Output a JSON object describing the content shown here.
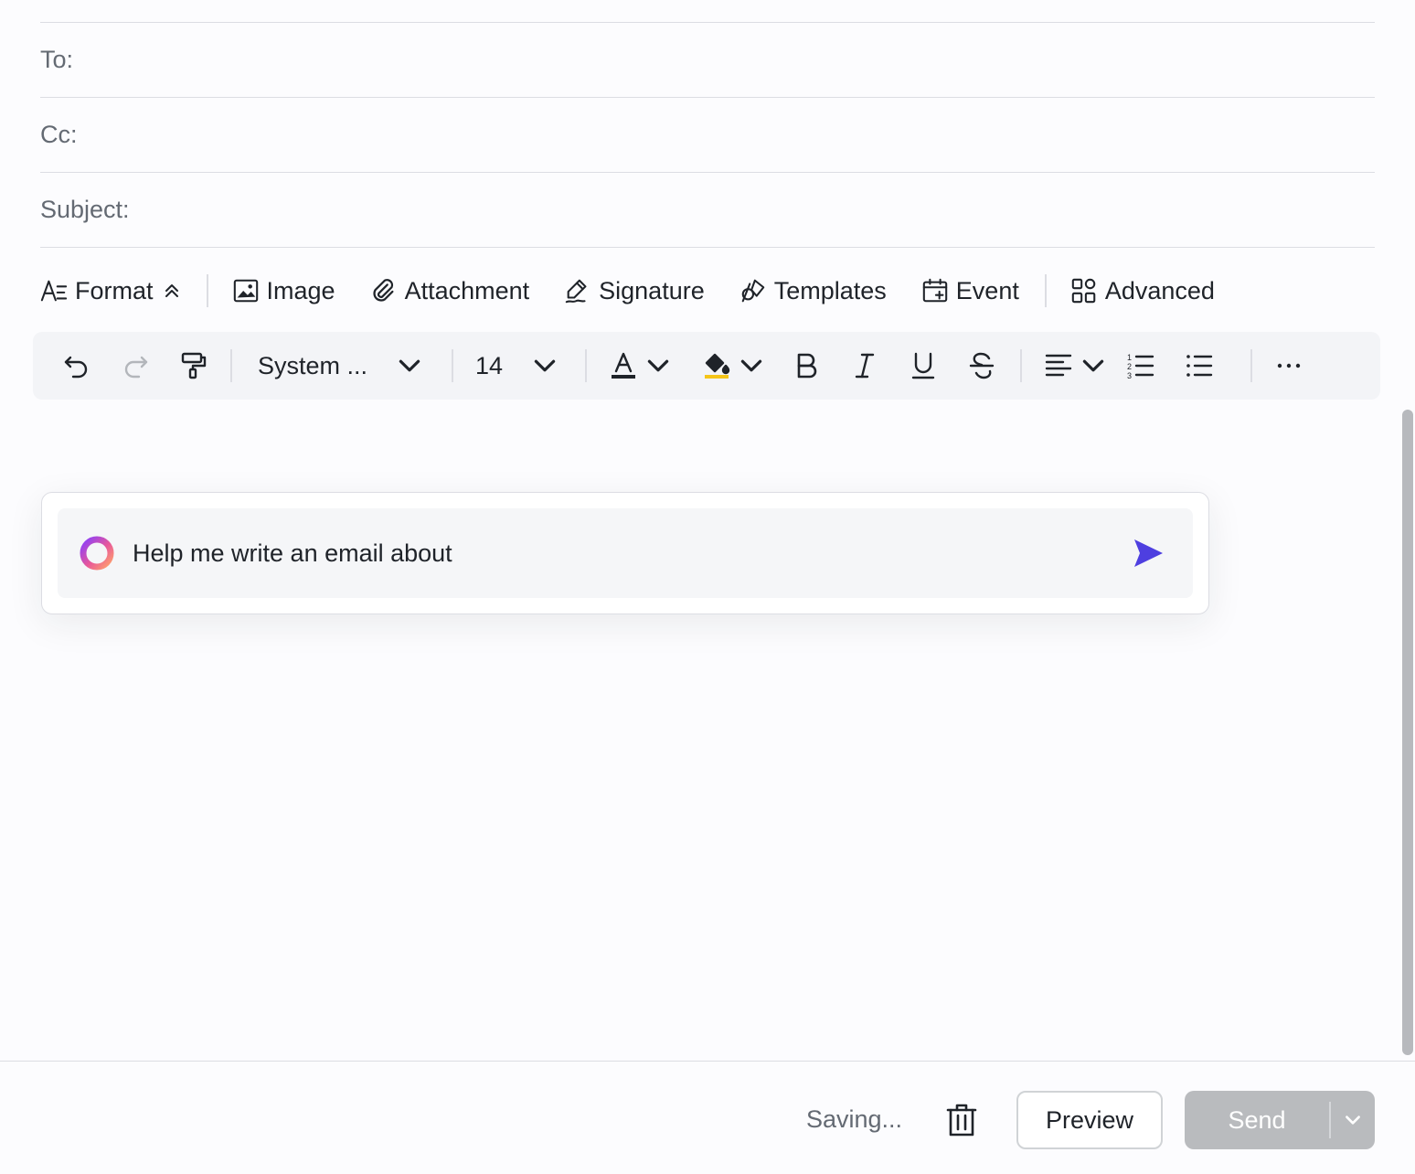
{
  "fields": {
    "to_label": "To:",
    "cc_label": "Cc:",
    "subject_label": "Subject:",
    "to_value": "",
    "cc_value": "",
    "subject_value": ""
  },
  "actions": {
    "format": "Format",
    "image": "Image",
    "attachment": "Attachment",
    "signature": "Signature",
    "templates": "Templates",
    "event": "Event",
    "advanced": "Advanced"
  },
  "toolbar": {
    "font_family": "System ...",
    "font_size": "14"
  },
  "colors": {
    "font_color": "#1f2329",
    "highlight_color": "#f5c518",
    "ai_send": "#4e3fe0",
    "send_button_disabled": "#b9bbbe"
  },
  "ai_prompt": {
    "placeholder": "Help me write an email about"
  },
  "footer": {
    "status": "Saving...",
    "preview_label": "Preview",
    "send_label": "Send"
  }
}
